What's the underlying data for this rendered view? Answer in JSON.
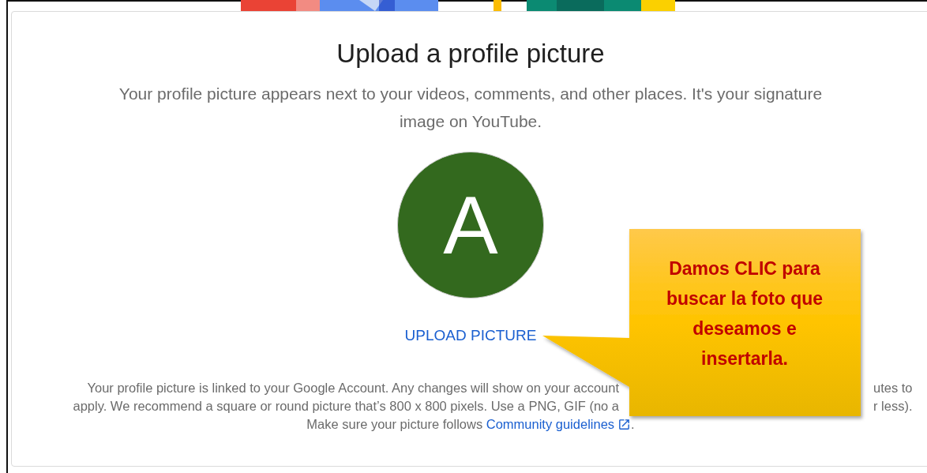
{
  "title": "Upload a profile picture",
  "description": "Your profile picture appears next to your videos, comments, and other places. It's your signature image on YouTube.",
  "avatar": {
    "initial": "A"
  },
  "upload_button": "UPLOAD PICTURE",
  "footer": {
    "lines": [
      {
        "left": "Your profile picture is linked to your Google Account. Any changes will show on your account",
        "right": "utes to"
      },
      {
        "left": "apply. We recommend a square or round picture that’s 800 x 800 pixels. Use a PNG, GIF (no a",
        "right": "r less)."
      }
    ],
    "last_line": {
      "text": "Make sure your picture follows",
      "link": "Community guidelines",
      "end": "."
    }
  },
  "callout": {
    "text": "Damos CLIC para buscar la foto que deseamos e insertarla."
  }
}
